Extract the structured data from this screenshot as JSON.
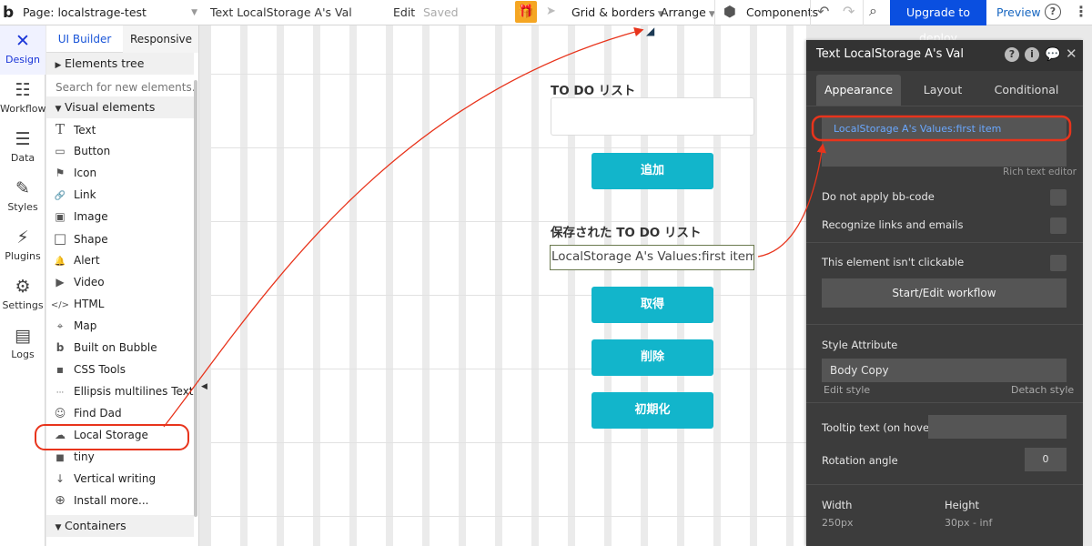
{
  "topbar": {
    "logo": "b",
    "page_label": "Page: localstrage-test",
    "element_name": "Text LocalStorage A's Val",
    "edit": "Edit",
    "saved": "Saved",
    "grid": "Grid & borders",
    "arrange": "Arrange",
    "components": "Components",
    "upgrade": "Upgrade to deploy",
    "preview": "Preview",
    "help": "?"
  },
  "rail": [
    {
      "label": "Design",
      "icon": "✕",
      "name": "design"
    },
    {
      "label": "Workflow",
      "icon": "☷",
      "name": "workflow"
    },
    {
      "label": "Data",
      "icon": "☰",
      "name": "data"
    },
    {
      "label": "Styles",
      "icon": "✎",
      "name": "styles"
    },
    {
      "label": "Plugins",
      "icon": "⚡",
      "name": "plugins"
    },
    {
      "label": "Settings",
      "icon": "⚙",
      "name": "settings"
    },
    {
      "label": "Logs",
      "icon": "▤",
      "name": "logs"
    }
  ],
  "panel": {
    "tab_ui": "UI Builder",
    "tab_resp": "Responsive",
    "elements_tree": "Elements tree",
    "search_placeholder": "Search for new elements...",
    "visual_elements": "Visual elements",
    "containers": "Containers",
    "items": [
      {
        "label": "Text",
        "icon": "T"
      },
      {
        "label": "Button",
        "icon": "▭"
      },
      {
        "label": "Icon",
        "icon": "⚑"
      },
      {
        "label": "Link",
        "icon": "🔗"
      },
      {
        "label": "Image",
        "icon": "▣"
      },
      {
        "label": "Shape",
        "icon": "□"
      },
      {
        "label": "Alert",
        "icon": "🔔"
      },
      {
        "label": "Video",
        "icon": "▶"
      },
      {
        "label": "HTML",
        "icon": "</>"
      },
      {
        "label": "Map",
        "icon": "⌖"
      },
      {
        "label": "Built on Bubble",
        "icon": "b"
      },
      {
        "label": "CSS Tools",
        "icon": "▪"
      },
      {
        "label": "Ellipsis multilines Text",
        "icon": "···"
      },
      {
        "label": "Find Dad",
        "icon": "☺"
      },
      {
        "label": "Local Storage",
        "icon": "☁"
      },
      {
        "label": "tiny",
        "icon": "■"
      },
      {
        "label": "Vertical writing",
        "icon": "↓"
      },
      {
        "label": "Install more...",
        "icon": "⊕"
      }
    ]
  },
  "canvas": {
    "todo_label": "TO DO リスト",
    "add_button": "追加",
    "saved_label": "保存された TO DO リスト",
    "text_value": "LocalStorage A's Values:first item",
    "get_button": "取得",
    "delete_button": "削除",
    "init_button": "初期化"
  },
  "property": {
    "title": "Text LocalStorage A's Val",
    "tab_appearance": "Appearance",
    "tab_layout": "Layout",
    "tab_conditional": "Conditional",
    "dynamic_text": "LocalStorage A's Values:first item",
    "rich_text_editor": "Rich text editor",
    "no_bbcode": "Do not apply bb-code",
    "recognize_links": "Recognize links and emails",
    "not_clickable": "This element isn't clickable",
    "workflow_button": "Start/Edit workflow",
    "style_attribute": "Style Attribute",
    "style_value": "Body Copy",
    "edit_style": "Edit style",
    "detach_style": "Detach style",
    "tooltip": "Tooltip text (on hover)",
    "rotation": "Rotation angle",
    "rotation_value": "0",
    "width_label": "Width",
    "width_value": "250px",
    "height_label": "Height",
    "height_value": "30px - inf"
  },
  "colors": {
    "accent": "#0a4fe0",
    "button": "#12b5cb",
    "annotation": "#e8341c"
  }
}
